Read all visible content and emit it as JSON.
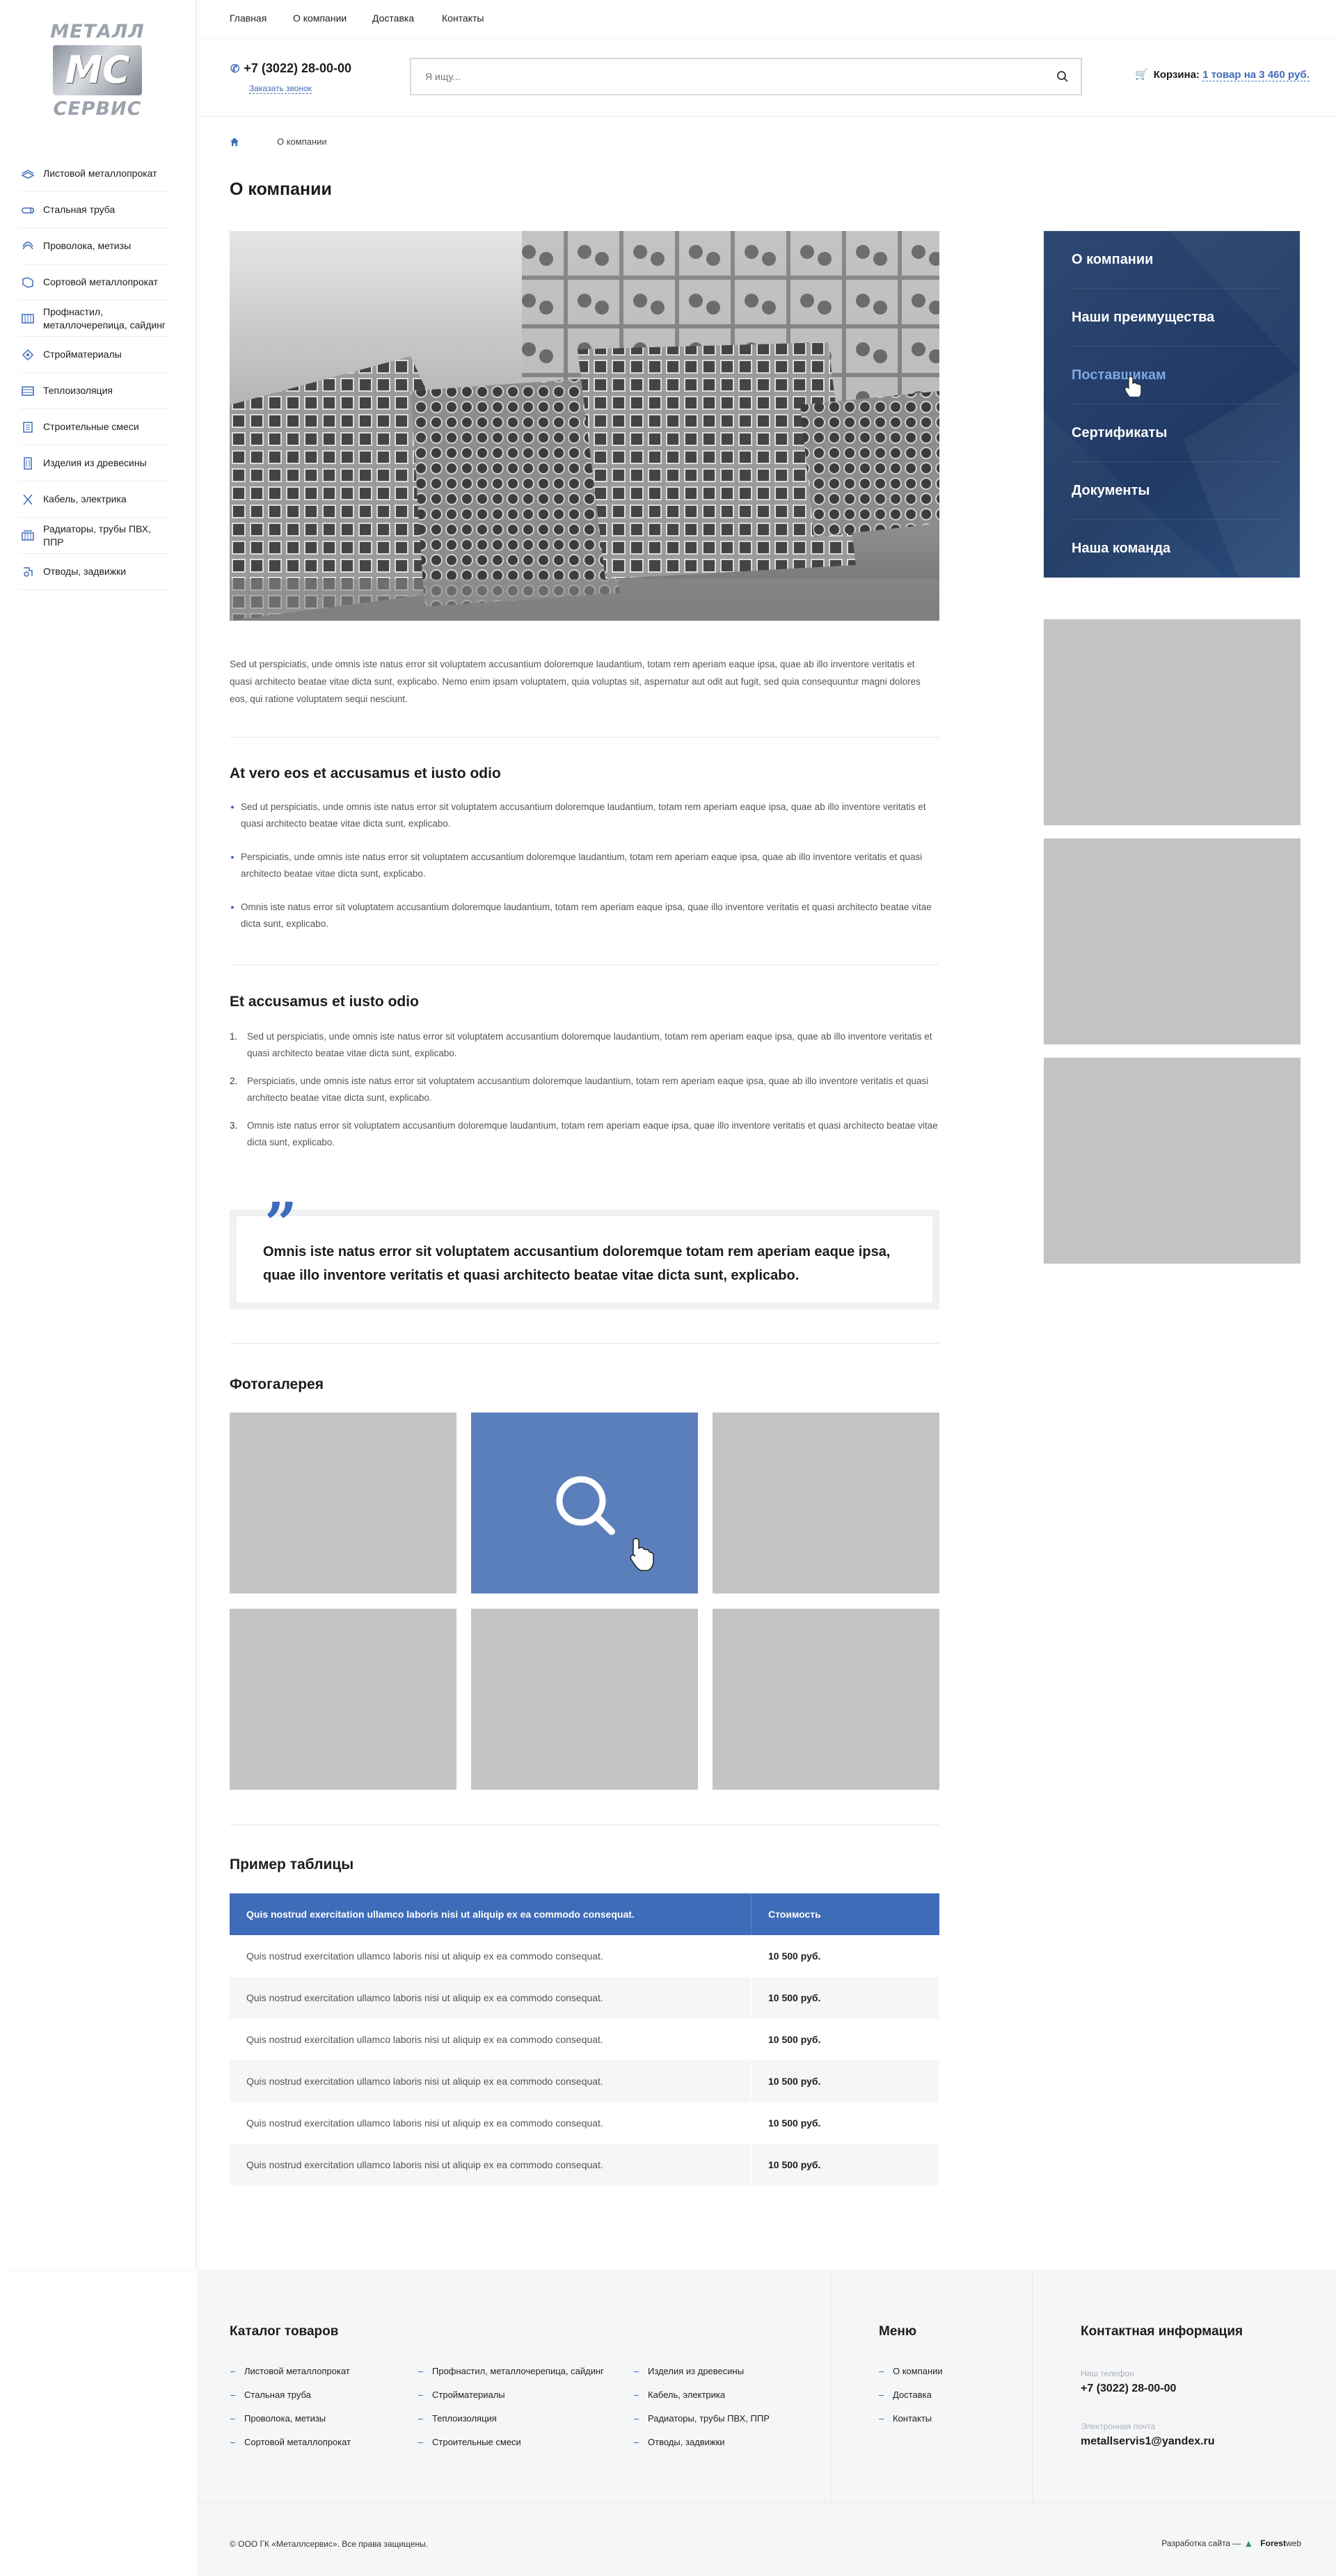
{
  "logo": {
    "top": "МЕТАЛЛ",
    "mark": "МС",
    "bottom": "СЕРВИС"
  },
  "sidebar": {
    "items": [
      {
        "label": "Листовой металлопрокат",
        "icon": "sheet-metal-icon"
      },
      {
        "label": "Стальная труба",
        "icon": "steel-pipe-icon"
      },
      {
        "label": "Проволока, метизы",
        "icon": "wire-icon"
      },
      {
        "label": "Сортовой металлопрокат",
        "icon": "section-metal-icon"
      },
      {
        "label": "Профнастил, металлочерепица, сайдинг",
        "icon": "roofing-icon"
      },
      {
        "label": "Стройматериалы",
        "icon": "building-materials-icon"
      },
      {
        "label": "Теплоизоляция",
        "icon": "insulation-icon"
      },
      {
        "label": "Строительные смеси",
        "icon": "mixtures-icon"
      },
      {
        "label": "Изделия из древесины",
        "icon": "wood-icon"
      },
      {
        "label": "Кабель, электрика",
        "icon": "cable-icon"
      },
      {
        "label": "Радиаторы, трубы ПВХ, ППР",
        "icon": "radiator-icon"
      },
      {
        "label": "Отводы, задвижки",
        "icon": "valve-icon"
      }
    ]
  },
  "topnav": {
    "items": [
      "Главная",
      "О компании",
      "Доставка",
      "Контакты"
    ]
  },
  "header": {
    "phone": "+7 (3022) 28-00-00",
    "callback": "Заказать звонок",
    "search_placeholder": "Я ищу...",
    "cart_label": "Корзина:",
    "cart_value": "1 товар на 3 460 руб."
  },
  "breadcrumb": {
    "current": "О компании"
  },
  "page_title": "О компании",
  "intro": "Sed ut perspiciatis, unde omnis iste natus error sit voluptatem accusantium doloremque laudantium, totam rem aperiam eaque ipsa, quae ab illo inventore veritatis et quasi architecto beatae vitae dicta sunt, explicabo. Nemo enim ipsam voluptatem, quia voluptas sit, aspernatur aut odit aut fugit, sed quia consequuntur magni dolores eos, qui ratione voluptatem sequi nesciunt.",
  "section1": {
    "title": "At vero eos et accusamus et iusto odio",
    "items": [
      "Sed ut perspiciatis, unde omnis iste natus error sit voluptatem accusantium doloremque laudantium, totam rem aperiam eaque ipsa, quae ab illo inventore veritatis et quasi architecto beatae vitae dicta sunt, explicabo.",
      "Perspiciatis, unde omnis iste natus error sit voluptatem accusantium doloremque laudantium, totam rem aperiam eaque ipsa, quae ab illo inventore veritatis et quasi architecto beatae vitae dicta sunt, explicabo.",
      "Omnis iste natus error sit voluptatem accusantium doloremque laudantium, totam rem aperiam eaque ipsa, quae illo inventore veritatis et quasi architecto beatae vitae dicta sunt, explicabo."
    ]
  },
  "section2": {
    "title": "Et accusamus et iusto odio",
    "items": [
      {
        "n": "1.",
        "text": "Sed ut perspiciatis, unde omnis iste natus error sit voluptatem accusantium doloremque laudantium, totam rem aperiam eaque ipsa, quae ab illo inventore veritatis et quasi architecto beatae vitae dicta sunt, explicabo."
      },
      {
        "n": "2.",
        "text": "Perspiciatis, unde omnis iste natus error sit voluptatem accusantium doloremque laudantium, totam rem aperiam eaque ipsa, quae ab illo inventore veritatis et quasi architecto beatae vitae dicta sunt, explicabo."
      },
      {
        "n": "3.",
        "text": "Omnis iste natus error sit voluptatem accusantium doloremque laudantium, totam rem aperiam eaque ipsa, quae illo inventore veritatis et quasi architecto beatae vitae dicta sunt, explicabo."
      }
    ]
  },
  "quote": {
    "mark": "”",
    "text": "Omnis iste natus error sit voluptatem accusantium doloremque totam rem aperiam eaque ipsa, quae illo inventore veritatis et quasi architecto beatae vitae dicta sunt, explicabo."
  },
  "gallery": {
    "title": "Фотогалерея",
    "count": 6,
    "active_index": 1
  },
  "table": {
    "title": "Пример таблицы",
    "header": [
      "Quis nostrud exercitation ullamco laboris nisi ut aliquip ex ea commodo consequat.",
      "Стоимость"
    ],
    "rows": [
      [
        "Quis nostrud exercitation ullamco laboris nisi ut aliquip ex ea commodo consequat.",
        "10 500 руб."
      ],
      [
        "Quis nostrud exercitation ullamco laboris nisi ut aliquip ex ea commodo consequat.",
        "10 500 руб."
      ],
      [
        "Quis nostrud exercitation ullamco laboris nisi ut aliquip ex ea commodo consequat.",
        "10 500 руб."
      ],
      [
        "Quis nostrud exercitation ullamco laboris nisi ut aliquip ex ea commodo consequat.",
        "10 500 руб."
      ],
      [
        "Quis nostrud exercitation ullamco laboris nisi ut aliquip ex ea commodo consequat.",
        "10 500 руб."
      ],
      [
        "Quis nostrud exercitation ullamco laboris nisi ut aliquip ex ea commodo consequat.",
        "10 500 руб."
      ]
    ]
  },
  "right_menu": {
    "items": [
      "О компании",
      "Наши преимущества",
      "Поставщикам",
      "Сертификаты",
      "Документы",
      "Наша команда"
    ],
    "active_index": 2
  },
  "footer": {
    "catalog_title": "Каталог товаров",
    "catalog_cols": [
      [
        "Листовой металлопрокат",
        "Стальная труба",
        "Проволока, метизы",
        "Сортовой металлопрокат"
      ],
      [
        "Профнастил, металлочерепица, сайдинг",
        "Стройматериалы",
        "Теплоизоляция",
        "Строительные смеси"
      ],
      [
        "Изделия из древесины",
        "Кабель, электрика",
        "Радиаторы, трубы ПВХ, ППР",
        "Отводы, задвижки"
      ]
    ],
    "menu_title": "Меню",
    "menu_items": [
      "О компании",
      "Доставка",
      "Контакты"
    ],
    "contact_title": "Контактная информация",
    "phone_label": "Наш телефон",
    "phone": "+7 (3022) 28-00-00",
    "email_label": "Электронная почта",
    "email": "metallservis1@yandex.ru",
    "copyright": "© ООО ГК «Металлсервис». Все права защищены.",
    "developer_label": "Разработка сайта —",
    "developer_brand": "Forest",
    "developer_suffix": "web"
  },
  "colors": {
    "accent": "#3f6cb8",
    "menu_bg": "#24406a",
    "placeholder": "#c3c3c3",
    "gallery_hover": "#5b7fbb"
  }
}
